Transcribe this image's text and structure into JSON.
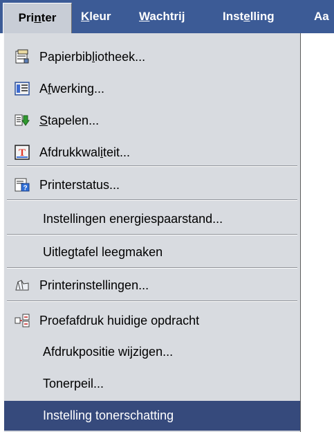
{
  "menubar": {
    "menus": [
      {
        "pre": "Pri",
        "m": "n",
        "post": "ter"
      },
      {
        "pre": "",
        "m": "K",
        "post": "leur"
      },
      {
        "pre": "",
        "m": "W",
        "post": "achtrij"
      },
      {
        "pre": "Inst",
        "m": "e",
        "post": "lling"
      },
      {
        "pre": "Aa",
        "m": "",
        "post": ""
      }
    ]
  },
  "dropdown": {
    "items": [
      {
        "pre": "Papierbib",
        "m": "l",
        "post": "iotheek...",
        "icon": "paper-library-icon"
      },
      {
        "pre": "A",
        "m": "f",
        "post": "werking...",
        "icon": "finishing-icon"
      },
      {
        "pre": "",
        "m": "S",
        "post": "tapelen...",
        "icon": "stacking-icon"
      },
      {
        "pre": "Afdrukkwal",
        "m": "i",
        "post": "teit...",
        "icon": "print-quality-icon"
      },
      {
        "pre": "Printerstatus...",
        "m": "",
        "post": "",
        "icon": "printer-status-icon"
      },
      {
        "pre": "Instellingen energiespaarstand...",
        "m": "",
        "post": ""
      },
      {
        "pre": "Uitlegtafel leegmaken",
        "m": "",
        "post": ""
      },
      {
        "pre": "Printerinstellingen...",
        "m": "",
        "post": "",
        "icon": "printer-settings-icon"
      },
      {
        "pre": "Proefafdruk huidige opdracht",
        "m": "",
        "post": "",
        "icon": "proof-print-icon"
      },
      {
        "pre": "Afdrukpositie wijzigen...",
        "m": "",
        "post": ""
      },
      {
        "pre": "Tonerpeil...",
        "m": "",
        "post": ""
      },
      {
        "pre": "Instelling tonerschatting",
        "m": "",
        "post": ""
      }
    ]
  },
  "colors": {
    "menubar_bg": "#3c5b96",
    "dropdown_bg": "#d8dbe0",
    "selected_bg": "#364a7c"
  }
}
